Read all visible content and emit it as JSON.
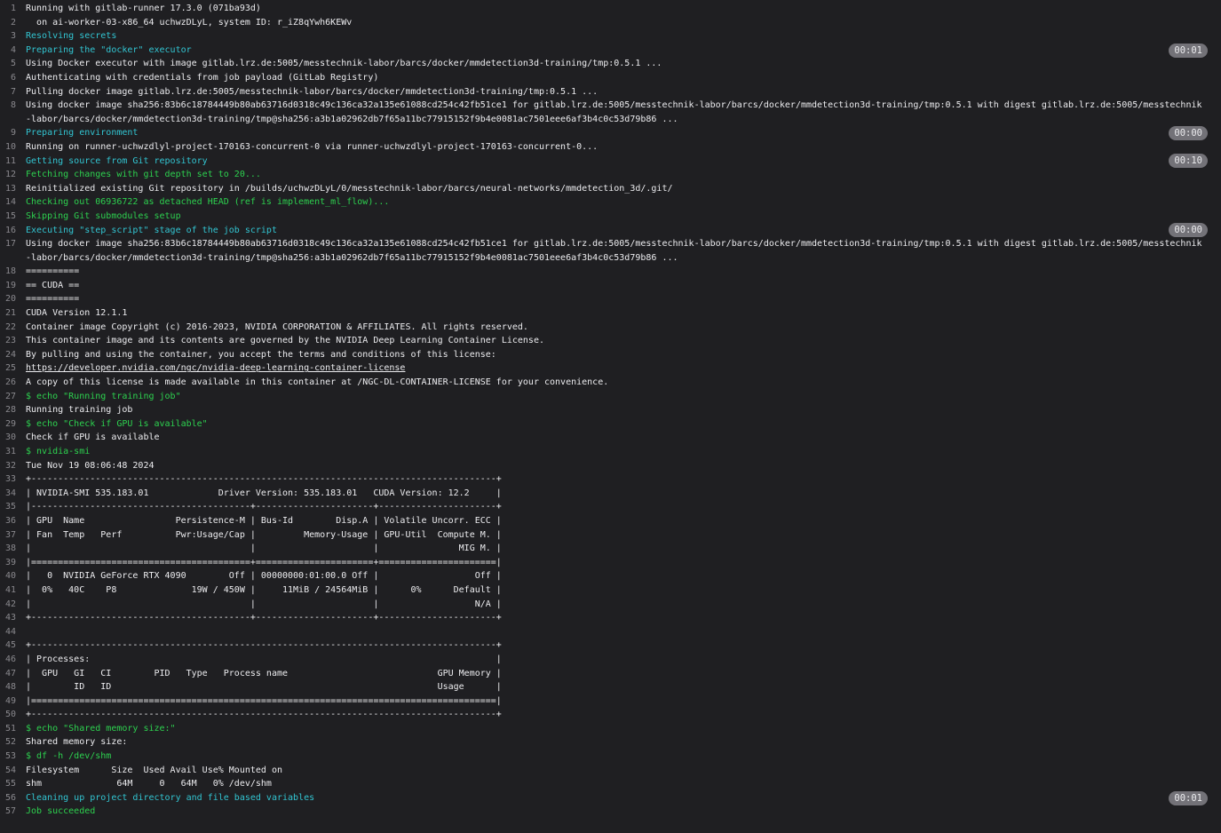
{
  "log": {
    "lines": [
      {
        "n": "1",
        "t": "Running with gitlab-runner 17.3.0 (071ba93d)",
        "c": "default"
      },
      {
        "n": "2",
        "t": "  on ai-worker-03-x86_64 uchwzDLyL, system ID: r_iZ8qYwh6KEWv",
        "c": "default"
      },
      {
        "n": "3",
        "t": "Resolving secrets",
        "c": "cyan"
      },
      {
        "n": "4",
        "t": "Preparing the \"docker\" executor",
        "c": "cyan",
        "badge": "00:01"
      },
      {
        "n": "5",
        "t": "Using Docker executor with image gitlab.lrz.de:5005/messtechnik-labor/barcs/docker/mmdetection3d-training/tmp:0.5.1 ...",
        "c": "default"
      },
      {
        "n": "6",
        "t": "Authenticating with credentials from job payload (GitLab Registry)",
        "c": "default"
      },
      {
        "n": "7",
        "t": "Pulling docker image gitlab.lrz.de:5005/messtechnik-labor/barcs/docker/mmdetection3d-training/tmp:0.5.1 ...",
        "c": "default"
      },
      {
        "n": "8",
        "t": "Using docker image sha256:83b6c18784449b80ab63716d0318c49c136ca32a135e61088cd254c42fb51ce1 for gitlab.lrz.de:5005/messtechnik-labor/barcs/docker/mmdetection3d-training/tmp:0.5.1 with digest gitlab.lrz.de:5005/messtechnik-labor/barcs/docker/mmdetection3d-training/tmp@sha256:a3b1a02962db7f65a11bc77915152f9b4e0081ac7501eee6af3b4c0c53d79b86 ...",
        "c": "default"
      },
      {
        "n": "9",
        "t": "Preparing environment",
        "c": "cyan",
        "badge": "00:00"
      },
      {
        "n": "10",
        "t": "Running on runner-uchwzdlyl-project-170163-concurrent-0 via runner-uchwzdlyl-project-170163-concurrent-0...",
        "c": "default"
      },
      {
        "n": "11",
        "t": "Getting source from Git repository",
        "c": "cyan",
        "badge": "00:10"
      },
      {
        "n": "12",
        "t": "Fetching changes with git depth set to 20...",
        "c": "green"
      },
      {
        "n": "13",
        "t": "Reinitialized existing Git repository in /builds/uchwzDLyL/0/messtechnik-labor/barcs/neural-networks/mmdetection_3d/.git/",
        "c": "default"
      },
      {
        "n": "14",
        "t": "Checking out 06936722 as detached HEAD (ref is implement_ml_flow)...",
        "c": "green"
      },
      {
        "n": "15",
        "t": "Skipping Git submodules setup",
        "c": "green"
      },
      {
        "n": "16",
        "t": "Executing \"step_script\" stage of the job script",
        "c": "cyan",
        "badge": "00:00"
      },
      {
        "n": "17",
        "t": "Using docker image sha256:83b6c18784449b80ab63716d0318c49c136ca32a135e61088cd254c42fb51ce1 for gitlab.lrz.de:5005/messtechnik-labor/barcs/docker/mmdetection3d-training/tmp:0.5.1 with digest gitlab.lrz.de:5005/messtechnik-labor/barcs/docker/mmdetection3d-training/tmp@sha256:a3b1a02962db7f65a11bc77915152f9b4e0081ac7501eee6af3b4c0c53d79b86 ...",
        "c": "default"
      },
      {
        "n": "18",
        "t": "==========",
        "c": "default"
      },
      {
        "n": "19",
        "t": "== CUDA ==",
        "c": "default"
      },
      {
        "n": "20",
        "t": "==========",
        "c": "default"
      },
      {
        "n": "21",
        "t": "CUDA Version 12.1.1",
        "c": "default"
      },
      {
        "n": "22",
        "t": "Container image Copyright (c) 2016-2023, NVIDIA CORPORATION & AFFILIATES. All rights reserved.",
        "c": "default"
      },
      {
        "n": "23",
        "t": "This container image and its contents are governed by the NVIDIA Deep Learning Container License.",
        "c": "default"
      },
      {
        "n": "24",
        "t": "By pulling and using the container, you accept the terms and conditions of this license:",
        "c": "default"
      },
      {
        "n": "25",
        "t": "https://developer.nvidia.com/ngc/nvidia-deep-learning-container-license",
        "c": "link"
      },
      {
        "n": "26",
        "t": "A copy of this license is made available in this container at /NGC-DL-CONTAINER-LICENSE for your convenience.",
        "c": "default"
      },
      {
        "n": "27",
        "t": "$ echo \"Running training job\"",
        "c": "green"
      },
      {
        "n": "28",
        "t": "Running training job",
        "c": "default"
      },
      {
        "n": "29",
        "t": "$ echo \"Check if GPU is available\"",
        "c": "green"
      },
      {
        "n": "30",
        "t": "Check if GPU is available",
        "c": "default"
      },
      {
        "n": "31",
        "t": "$ nvidia-smi",
        "c": "green"
      },
      {
        "n": "32",
        "t": "Tue Nov 19 08:06:48 2024",
        "c": "default"
      },
      {
        "n": "33",
        "t": "+---------------------------------------------------------------------------------------+",
        "c": "default"
      },
      {
        "n": "34",
        "t": "| NVIDIA-SMI 535.183.01             Driver Version: 535.183.01   CUDA Version: 12.2     |",
        "c": "default"
      },
      {
        "n": "35",
        "t": "|-----------------------------------------+----------------------+----------------------+",
        "c": "default"
      },
      {
        "n": "36",
        "t": "| GPU  Name                 Persistence-M | Bus-Id        Disp.A | Volatile Uncorr. ECC |",
        "c": "default"
      },
      {
        "n": "37",
        "t": "| Fan  Temp   Perf          Pwr:Usage/Cap |         Memory-Usage | GPU-Util  Compute M. |",
        "c": "default"
      },
      {
        "n": "38",
        "t": "|                                         |                      |               MIG M. |",
        "c": "default"
      },
      {
        "n": "39",
        "t": "|=========================================+======================+======================|",
        "c": "default"
      },
      {
        "n": "40",
        "t": "|   0  NVIDIA GeForce RTX 4090        Off | 00000000:01:00.0 Off |                  Off |",
        "c": "default"
      },
      {
        "n": "41",
        "t": "|  0%   40C    P8              19W / 450W |     11MiB / 24564MiB |      0%      Default |",
        "c": "default"
      },
      {
        "n": "42",
        "t": "|                                         |                      |                  N/A |",
        "c": "default"
      },
      {
        "n": "43",
        "t": "+-----------------------------------------+----------------------+----------------------+",
        "c": "default"
      },
      {
        "n": "44",
        "t": "",
        "c": "default"
      },
      {
        "n": "45",
        "t": "+---------------------------------------------------------------------------------------+",
        "c": "default"
      },
      {
        "n": "46",
        "t": "| Processes:                                                                            |",
        "c": "default"
      },
      {
        "n": "47",
        "t": "|  GPU   GI   CI        PID   Type   Process name                            GPU Memory |",
        "c": "default"
      },
      {
        "n": "48",
        "t": "|        ID   ID                                                             Usage      |",
        "c": "default"
      },
      {
        "n": "49",
        "t": "|=======================================================================================|",
        "c": "default"
      },
      {
        "n": "50",
        "t": "+---------------------------------------------------------------------------------------+",
        "c": "default"
      },
      {
        "n": "51",
        "t": "$ echo \"Shared memory size:\"",
        "c": "green"
      },
      {
        "n": "52",
        "t": "Shared memory size:",
        "c": "default"
      },
      {
        "n": "53",
        "t": "$ df -h /dev/shm",
        "c": "green"
      },
      {
        "n": "54",
        "t": "Filesystem      Size  Used Avail Use% Mounted on",
        "c": "default"
      },
      {
        "n": "55",
        "t": "shm              64M     0   64M   0% /dev/shm",
        "c": "default"
      },
      {
        "n": "56",
        "t": "Cleaning up project directory and file based variables",
        "c": "cyan",
        "badge": "00:01"
      },
      {
        "n": "57",
        "t": "Job succeeded",
        "c": "green"
      }
    ]
  },
  "colors": {
    "background": "#1f1f22",
    "text": "#ececef",
    "section": "#32c5d2",
    "command": "#2dd14f",
    "line_number": "#89888d",
    "badge_bg": "#737278"
  }
}
